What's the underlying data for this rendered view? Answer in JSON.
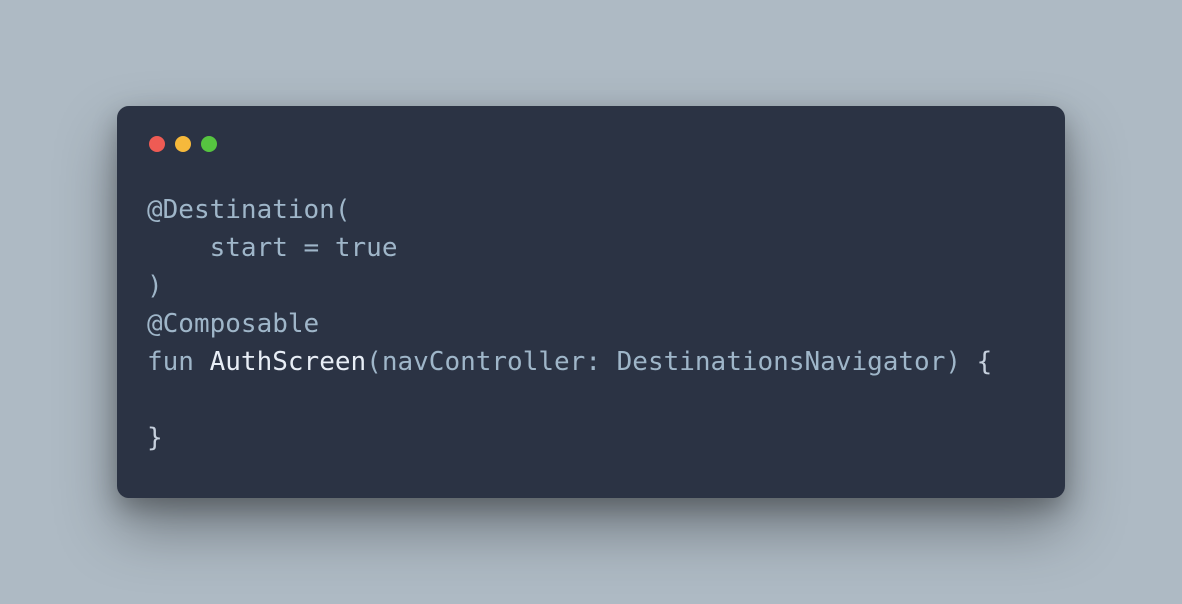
{
  "colors": {
    "background": "#aebac4",
    "window_bg": "#2b3344",
    "dot_red": "#ee5b54",
    "dot_yellow": "#f6b93b",
    "dot_green": "#56c440"
  },
  "code": {
    "lines": [
      {
        "tokens": [
          {
            "cls": "tok-annotation",
            "text": "@Destination"
          },
          {
            "cls": "tok-punct",
            "text": "("
          }
        ]
      },
      {
        "tokens": [
          {
            "cls": "tok-punct",
            "text": "    "
          },
          {
            "cls": "tok-param",
            "text": "start"
          },
          {
            "cls": "tok-operator",
            "text": " = "
          },
          {
            "cls": "tok-literal",
            "text": "true"
          }
        ]
      },
      {
        "tokens": [
          {
            "cls": "tok-punct",
            "text": ")"
          }
        ]
      },
      {
        "tokens": [
          {
            "cls": "tok-annotation",
            "text": "@Composable"
          }
        ]
      },
      {
        "tokens": [
          {
            "cls": "tok-keyword",
            "text": "fun"
          },
          {
            "cls": "tok-punct",
            "text": " "
          },
          {
            "cls": "tok-funcname",
            "text": "AuthScreen"
          },
          {
            "cls": "tok-punct",
            "text": "("
          },
          {
            "cls": "tok-param",
            "text": "navController"
          },
          {
            "cls": "tok-punct",
            "text": ": "
          },
          {
            "cls": "tok-type",
            "text": "DestinationsNavigator"
          },
          {
            "cls": "tok-punct",
            "text": ")"
          },
          {
            "cls": "tok-brace",
            "text": " {"
          }
        ]
      },
      {
        "tokens": [
          {
            "cls": "tok-punct",
            "text": ""
          }
        ]
      },
      {
        "tokens": [
          {
            "cls": "tok-brace",
            "text": "}"
          }
        ]
      }
    ]
  }
}
